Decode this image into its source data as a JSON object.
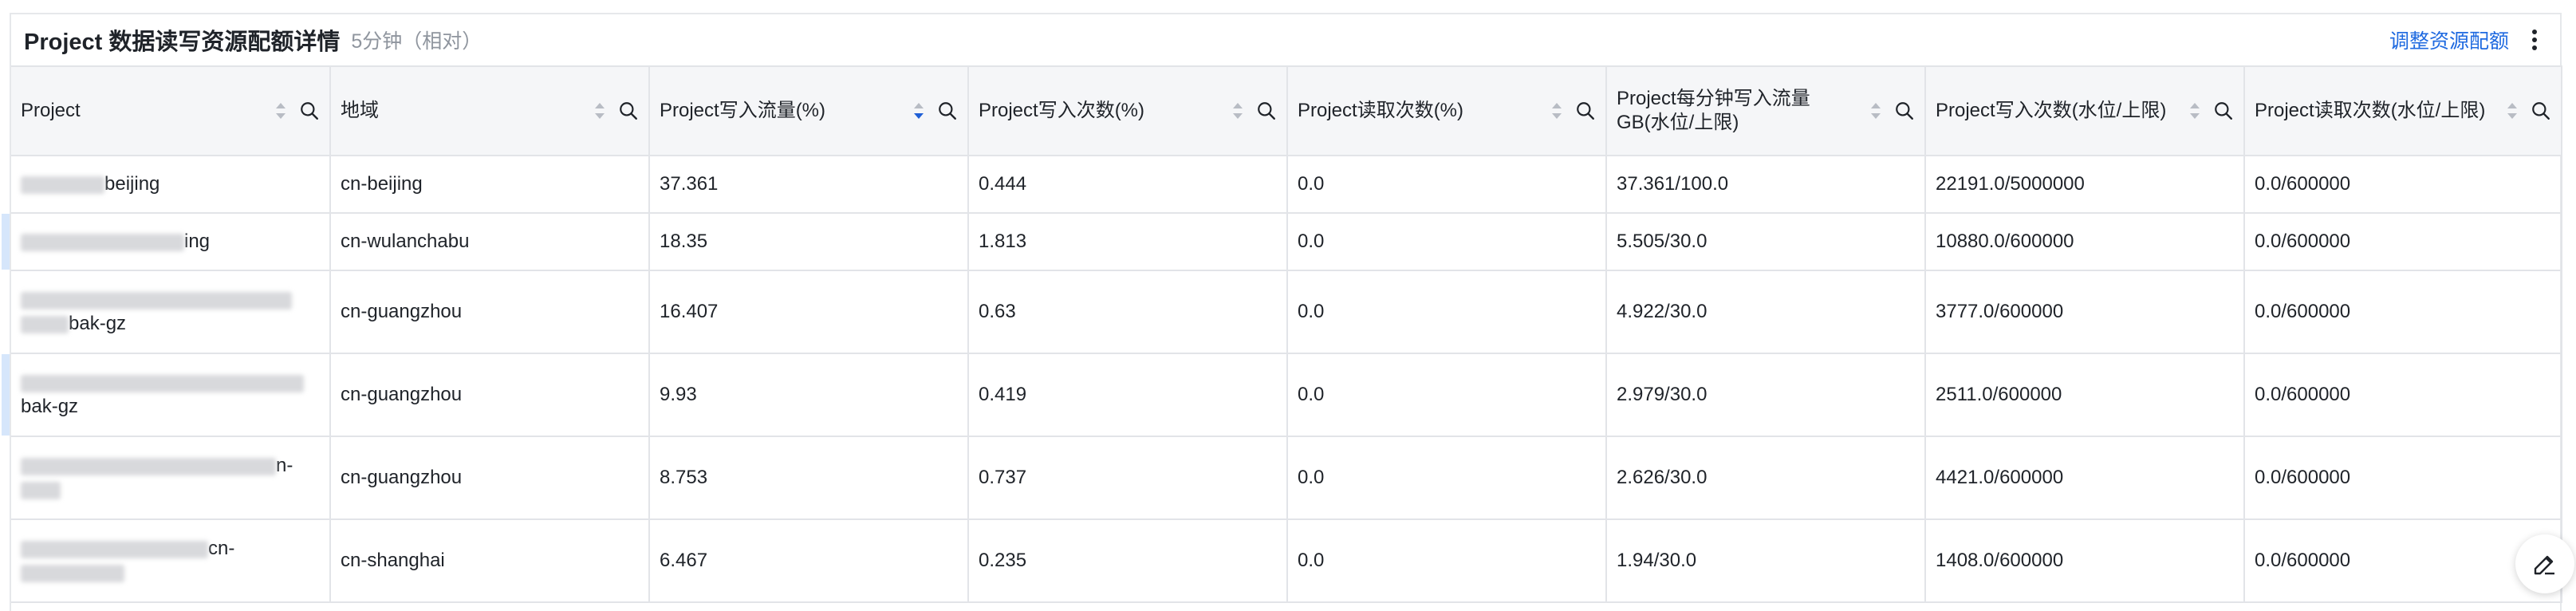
{
  "panel": {
    "title": "Project 数据读写资源配额详情",
    "subtitle": "5分钟（相对）",
    "adjust_label": "调整资源配额"
  },
  "columns": [
    {
      "label": "Project"
    },
    {
      "label": "地域"
    },
    {
      "label": "Project写入流量(%)",
      "sorted": "desc"
    },
    {
      "label": "Project写入次数(%)"
    },
    {
      "label": "Project读取次数(%)"
    },
    {
      "label": "Project每分钟写入流量GB(水位/上限)"
    },
    {
      "label": "Project写入次数(水位/上限)"
    },
    {
      "label": "Project读取次数(水位/上限)"
    }
  ],
  "rows": [
    {
      "project_visible": "beijing",
      "region": "cn-beijing",
      "write_traffic": "37.361",
      "write_count": "0.444",
      "read_count": "0.0",
      "gb_per_min": "37.361/100.0",
      "write_quota": "22191.0/5000000",
      "read_quota": "0.0/600000"
    },
    {
      "project_visible": "ing",
      "region": "cn-wulanchabu",
      "write_traffic": "18.35",
      "write_count": "1.813",
      "read_count": "0.0",
      "gb_per_min": "5.505/30.0",
      "write_quota": "10880.0/600000",
      "read_quota": "0.0/600000"
    },
    {
      "project_visible": "bak-gz",
      "region": "cn-guangzhou",
      "write_traffic": "16.407",
      "write_count": "0.63",
      "read_count": "0.0",
      "gb_per_min": "4.922/30.0",
      "write_quota": "3777.0/600000",
      "read_quota": "0.0/600000"
    },
    {
      "project_visible": "bak-gz",
      "region": "cn-guangzhou",
      "write_traffic": "9.93",
      "write_count": "0.419",
      "read_count": "0.0",
      "gb_per_min": "2.979/30.0",
      "write_quota": "2511.0/600000",
      "read_quota": "0.0/600000"
    },
    {
      "project_visible": "n-",
      "region": "cn-guangzhou",
      "write_traffic": "8.753",
      "write_count": "0.737",
      "read_count": "0.0",
      "gb_per_min": "2.626/30.0",
      "write_quota": "4421.0/600000",
      "read_quota": "0.0/600000"
    },
    {
      "project_visible": "cn-",
      "region": "cn-shanghai",
      "write_traffic": "6.467",
      "write_count": "0.235",
      "read_count": "0.0",
      "gb_per_min": "1.94/30.0",
      "write_quota": "1408.0/600000",
      "read_quota": "0.0/600000"
    }
  ]
}
